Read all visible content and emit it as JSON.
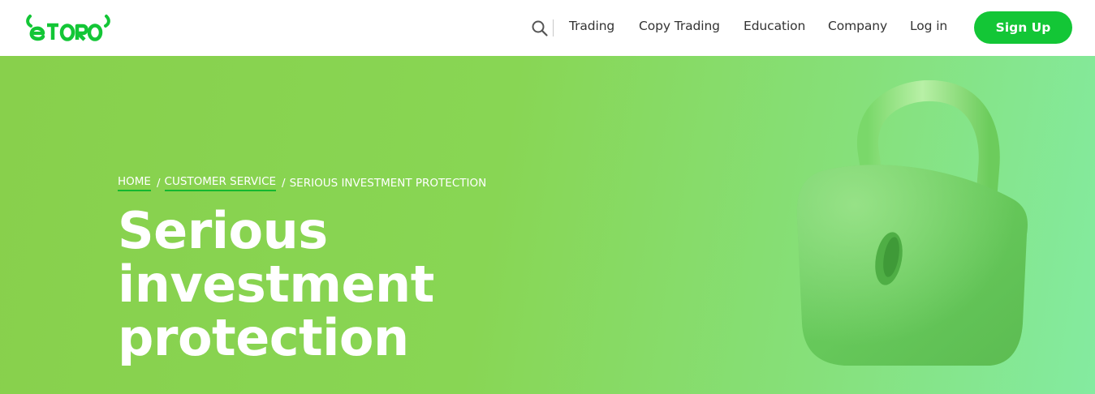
{
  "brand": {
    "logo_text": "eToro",
    "logo_color": "#13c636"
  },
  "nav": {
    "search_icon": "search-icon",
    "items": [
      "Trading",
      "Copy Trading",
      "Education",
      "Company"
    ],
    "login_label": "Log in",
    "signup_label": "Sign Up",
    "signup_color": "#13c636"
  },
  "breadcrumb": {
    "items": [
      "HOME",
      "CUSTOMER SERVICE"
    ],
    "separator": "/",
    "current": "SERIOUS INVESTMENT PROTECTION"
  },
  "hero": {
    "title_line1": "Serious investment",
    "title_line2": "protection",
    "illustration": "padlock-icon",
    "background_colors": [
      "#88d04c",
      "#84eba0"
    ]
  }
}
